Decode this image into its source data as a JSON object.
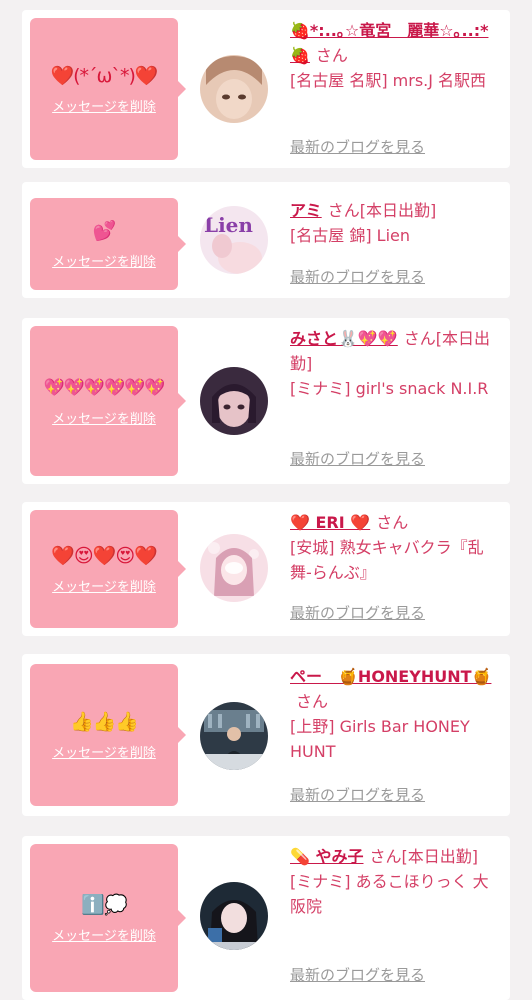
{
  "delete_label": "メッセージを削除",
  "blog_label": "最新のブログを見る",
  "honorific": "さん",
  "entries": [
    {
      "emoji": "❤️(*´ω`*)❤️",
      "name": "🍓*:..｡☆竜宮　麗華☆｡..:*🍓",
      "status": "",
      "shop": "[名古屋 名駅] mrs.J 名駅西",
      "avatar_colors": [
        "#e7c9b6",
        "#b78a71"
      ]
    },
    {
      "emoji": "💕",
      "name": "アミ",
      "status": "[本日出勤]",
      "shop": "[名古屋 錦] Lien",
      "avatar_colors": [
        "#f4e6ef",
        "#8a3fa8"
      ]
    },
    {
      "emoji": "💖💖💖💖💖💖",
      "name": "みさと🐰💖💖",
      "status": "[本日出勤]",
      "shop": "[ミナミ] girl's snack N.I.R",
      "avatar_colors": [
        "#3a2a3e",
        "#c9a1b5"
      ]
    },
    {
      "emoji": "❤️😍❤️😍❤️",
      "name": "❤️ ERI ❤️",
      "status": "",
      "shop": "[安城] 熟女キャバクラ『乱舞-らんぶ』",
      "avatar_colors": [
        "#f7dfe6",
        "#d9a0b4"
      ]
    },
    {
      "emoji": "👍👍👍",
      "name": "ペー　🍯HONEYHUNT🍯",
      "status": "",
      "shop": "[上野] Girls Bar HONEY HUNT",
      "avatar_colors": [
        "#2e3a46",
        "#6a7f8e"
      ]
    },
    {
      "emoji": "ℹ️💭",
      "name": "💊 やみ子",
      "status": "[本日出勤]",
      "shop": "[ミナミ] あるこほりっく 大阪院",
      "avatar_colors": [
        "#1e2a36",
        "#c7ccd4"
      ]
    }
  ]
}
